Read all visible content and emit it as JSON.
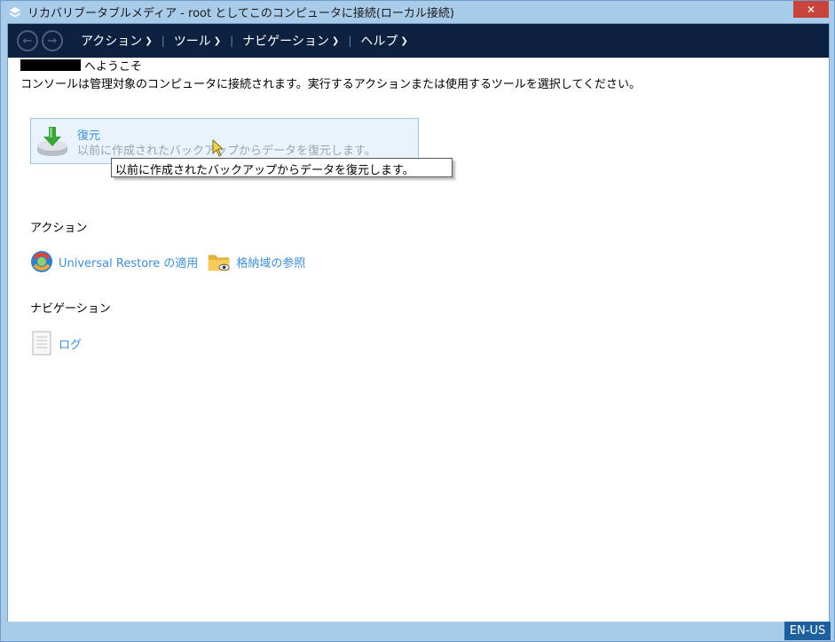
{
  "window": {
    "title": "リカバリブータブルメディア - root としてこのコンピュータに接続(ローカル接続)",
    "close_label": "✕"
  },
  "menubar": {
    "items": [
      {
        "label": "アクション"
      },
      {
        "label": "ツール"
      },
      {
        "label": "ナビゲーション"
      },
      {
        "label": "ヘルプ"
      }
    ]
  },
  "main": {
    "welcome_suffix": "へようこそ",
    "intro": "コンソールは管理対象のコンピュータに接続されます。実行するアクションまたは使用するツールを選択してください。",
    "restore": {
      "title": "復元",
      "description": "以前に作成されたバックアップからデータを復元します。",
      "tooltip": "以前に作成されたバックアップからデータを復元します。"
    },
    "actions_heading": "アクション",
    "actions": [
      {
        "label": "Universal Restore の適用",
        "icon": "universal-restore-icon"
      },
      {
        "label": "格納域の参照",
        "icon": "folder-browse-icon"
      }
    ],
    "navigation_heading": "ナビゲーション",
    "navigation": [
      {
        "label": "ログ",
        "icon": "log-document-icon"
      }
    ]
  },
  "status": {
    "language": "EN-US"
  },
  "colors": {
    "menubar_bg": "#0c2040",
    "link": "#3f8fd6",
    "titlebar": "#a9cbea",
    "close": "#c7453b"
  }
}
